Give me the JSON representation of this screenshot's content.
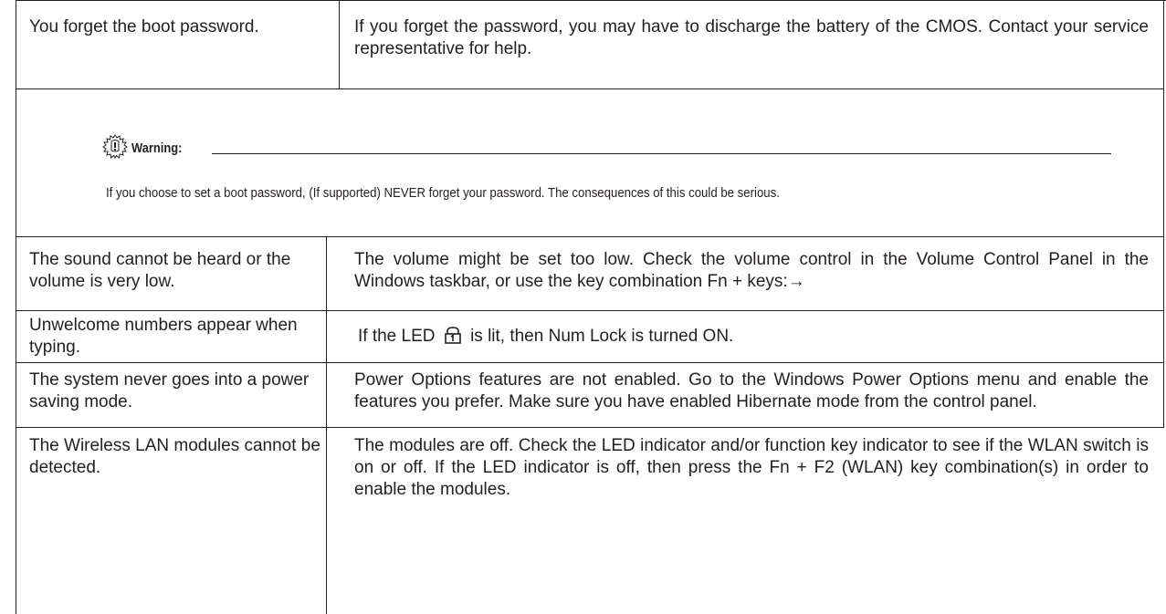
{
  "rows": [
    {
      "problem": "You forget the boot password.",
      "solution": "If you forget the password, you may have to discharge the battery of the CMOS. Contact your service representative for help."
    },
    {
      "problem": "The sound cannot be heard or the volume is very low.",
      "solution": "The volume might be set too low. Check the volume control in the Volume Control Panel in the Windows taskbar, or use the key combination Fn + keys:→"
    },
    {
      "problem": "Unwelcome numbers appear when typing.",
      "solution_before": "If the LED",
      "solution_after": "is lit, then Num Lock is turned ON.",
      "solution_icon": "num-lock-icon"
    },
    {
      "problem": "The system never goes into a power saving mode.",
      "solution": "Power Options features are not enabled. Go to the Windows Power Options menu and enable the features you prefer. Make sure you have enabled Hibernate mode from the control panel."
    },
    {
      "problem": "The Wireless LAN modules cannot be detected.",
      "solution": "The modules are off. Check the LED indicator and/or function key indicator to see if the WLAN switch is on or off. If the LED indicator is off, then press the Fn + F2 (WLAN) key combination(s) in order to enable the modules."
    }
  ],
  "warning": {
    "icon": "warning-icon",
    "title": "Warning:",
    "text": "If you choose to set a boot password, (If supported) NEVER forget your password. The consequences of this could be serious."
  }
}
